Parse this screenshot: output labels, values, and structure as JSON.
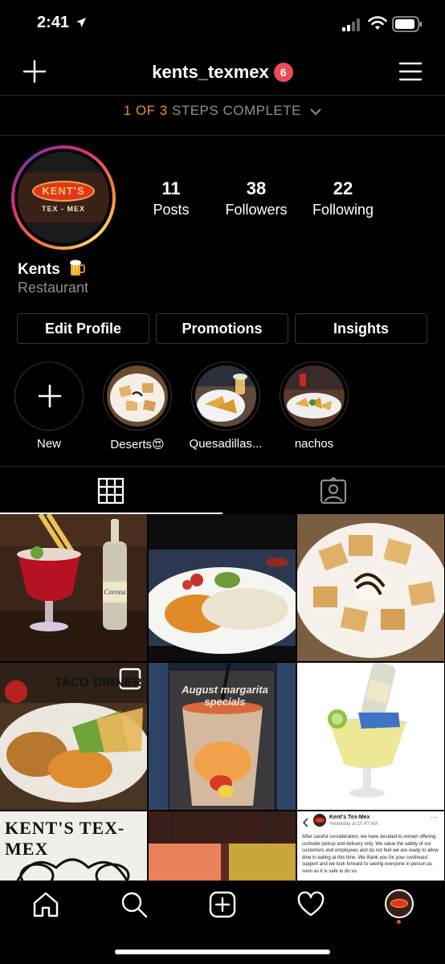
{
  "status_bar": {
    "time": "2:41"
  },
  "header": {
    "username": "kents_texmex",
    "notification_count": "6"
  },
  "steps": {
    "progress": "1 OF 3",
    "label": "STEPS COMPLETE"
  },
  "profile": {
    "name": "Kents",
    "category": "Restaurant",
    "avatar_logo_text": "KENT'S",
    "avatar_logo_subtext": "TEX - MEX"
  },
  "stats": [
    {
      "value": "11",
      "label": "Posts"
    },
    {
      "value": "38",
      "label": "Followers"
    },
    {
      "value": "22",
      "label": "Following"
    }
  ],
  "buttons": {
    "edit_profile": "Edit Profile",
    "promotions": "Promotions",
    "insights": "Insights"
  },
  "highlights": [
    {
      "label": "New"
    },
    {
      "label": "Deserts😍"
    },
    {
      "label": "Quesadillas..."
    },
    {
      "label": "nachos"
    }
  ],
  "grid": {
    "post4_text": "TACO DINNER",
    "post5_text_line1": "August margarita",
    "post5_text_line2": "specials",
    "post7_text": "KENT'S TEX-MEX",
    "post9_page": "Kent's Tex-Mex",
    "post9_time": "Yesterday at 10:47 AM · ",
    "post9_body": "After careful consideration, we have decided to remain offering curbside pickup and delivery only. We value the safety of our customers and employees and do not feel we are ready to allow dine in eating at this time. We thank you for your continued support and we look forward to seeing everyone in person as soon as it is safe to do so."
  },
  "colors": {
    "accent_orange": "#f08a1c",
    "badge_red": "#ed4956",
    "muted": "#8e8e8e",
    "border": "#363636"
  }
}
